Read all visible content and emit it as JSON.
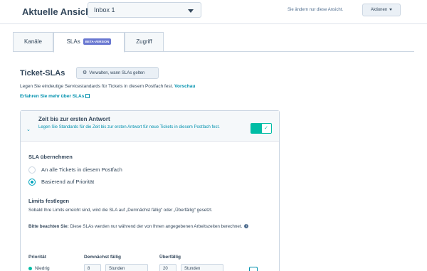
{
  "header": {
    "view_label": "Aktuelle Ansicht:",
    "selected_inbox": "Inbox 1",
    "note": "Sie ändern nur diese Ansicht.",
    "actions_label": "Aktionen"
  },
  "tabs": [
    {
      "label": "Kanäle",
      "active": false
    },
    {
      "label": "SLAs",
      "active": true,
      "badge": "BETA-VERSION"
    },
    {
      "label": "Zugriff",
      "active": false
    }
  ],
  "section": {
    "title": "Ticket-SLAs",
    "manage_button": "Verwalten, wann SLAs gelten",
    "description": "Legen Sie eindeutige Servicestandards für Tickets in diesem Postfach fest.",
    "preview_link": "Vorschau",
    "learn_more_link": "Erfahren Sie mehr über SLAs"
  },
  "card": {
    "title": "Zeit bis zur ersten Antwort",
    "description": "Legen Sie Standards für die Zeit bis zur ersten Antwort für neue Tickets in diesem Postfach fest.",
    "toggle_on": true,
    "apply_title": "SLA übernehmen",
    "options": [
      {
        "label": "An alle Tickets in diesem Postfach",
        "checked": false
      },
      {
        "label": "Basierend auf Priorität",
        "checked": true
      }
    ],
    "limits_title": "Limits festlegen",
    "limits_desc": "Sobald Ihre Limits erreicht sind, wird die SLA auf „Demnächst fällig“ oder „Überfällig“ gesetzt.",
    "note_label": "Bitte beachten Sie:",
    "note_text": "Diese SLAs werden nur während der von Ihnen angegebenen Arbeitszeiten berechnet.",
    "columns": [
      "Priorität",
      "Demnächst fällig",
      "Überfällig"
    ],
    "row": {
      "priority": "Niedrig",
      "due_soon_value": "8",
      "due_soon_unit": "Stunden",
      "overdue_value": "20",
      "overdue_unit": "Stunden"
    }
  },
  "colors": {
    "accent": "#00bda5",
    "link": "#0091ae",
    "beta": "#6a78d1"
  }
}
